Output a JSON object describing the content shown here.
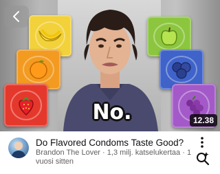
{
  "video": {
    "title": "Do Flavored Condoms Taste Good?",
    "channel": "Brandon The Lover",
    "views": "1,3 milj. katselukertaa",
    "age": "1 vuosi sitten",
    "separator": "·",
    "duration": "12.38",
    "overlay_text": "No."
  },
  "icons": {
    "back": "chevron-left-icon",
    "more": "more-vert-icon",
    "lens": "lens-search-icon",
    "avatar": "channel-avatar"
  },
  "colors": {
    "title_text": "#0f0f0f",
    "subtitle_text": "#606060",
    "packs": [
      "#f2d13a",
      "#f39a20",
      "#e5382c",
      "#8cc63f",
      "#3f63c9",
      "#a35ac8"
    ]
  }
}
